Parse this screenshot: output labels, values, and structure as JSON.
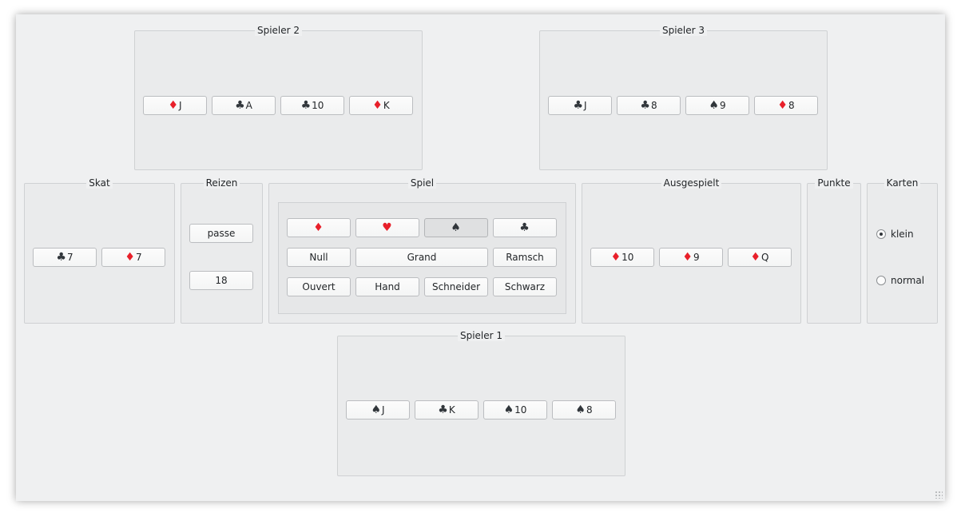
{
  "groups": {
    "spieler2": "Spieler 2",
    "spieler3": "Spieler 3",
    "skat": "Skat",
    "reizen": "Reizen",
    "spiel": "Spiel",
    "ausgespielt": "Ausgespielt",
    "punkte": "Punkte",
    "karten": "Karten",
    "spieler1": "Spieler 1"
  },
  "suits": {
    "diamonds": {
      "glyph": "♦",
      "color": "#e8202a"
    },
    "hearts": {
      "glyph": "♥",
      "color": "#e8202a"
    },
    "spades": {
      "glyph": "♠",
      "color": "#31363b"
    },
    "clubs": {
      "glyph": "♣",
      "color": "#31363b"
    }
  },
  "spieler2_cards": [
    {
      "suit": "diamonds",
      "glyph": "♦",
      "rank": "J"
    },
    {
      "suit": "clubs",
      "glyph": "♣",
      "rank": "A"
    },
    {
      "suit": "clubs",
      "glyph": "♣",
      "rank": "10"
    },
    {
      "suit": "diamonds",
      "glyph": "♦",
      "rank": "K"
    }
  ],
  "spieler3_cards": [
    {
      "suit": "clubs",
      "glyph": "♣",
      "rank": "J"
    },
    {
      "suit": "clubs",
      "glyph": "♣",
      "rank": "8"
    },
    {
      "suit": "spades",
      "glyph": "♠",
      "rank": "9"
    },
    {
      "suit": "diamonds",
      "glyph": "♦",
      "rank": "8"
    }
  ],
  "skat_cards": [
    {
      "suit": "clubs",
      "glyph": "♣",
      "rank": "7"
    },
    {
      "suit": "diamonds",
      "glyph": "♦",
      "rank": "7"
    }
  ],
  "reizen": {
    "pass_label": "passe",
    "bid_label": "18"
  },
  "spiel": {
    "suit_buttons": [
      {
        "suit": "diamonds",
        "glyph": "♦",
        "pressed": false
      },
      {
        "suit": "hearts",
        "glyph": "♥",
        "pressed": false
      },
      {
        "suit": "spades",
        "glyph": "♠",
        "pressed": true
      },
      {
        "suit": "clubs",
        "glyph": "♣",
        "pressed": false
      }
    ],
    "null_label": "Null",
    "grand_label": "Grand",
    "ramsch_label": "Ramsch",
    "ouvert_label": "Ouvert",
    "hand_label": "Hand",
    "schneider_label": "Schneider",
    "schwarz_label": "Schwarz"
  },
  "ausgespielt_cards": [
    {
      "suit": "diamonds",
      "glyph": "♦",
      "rank": "10"
    },
    {
      "suit": "diamonds",
      "glyph": "♦",
      "rank": "9"
    },
    {
      "suit": "diamonds",
      "glyph": "♦",
      "rank": "Q"
    }
  ],
  "karten": {
    "options": [
      {
        "label": "klein",
        "checked": true
      },
      {
        "label": "normal",
        "checked": false
      }
    ]
  },
  "spieler1_cards": [
    {
      "suit": "spades",
      "glyph": "♠",
      "rank": "J"
    },
    {
      "suit": "clubs",
      "glyph": "♣",
      "rank": "K"
    },
    {
      "suit": "spades",
      "glyph": "♠",
      "rank": "10"
    },
    {
      "suit": "spades",
      "glyph": "♠",
      "rank": "8"
    }
  ]
}
